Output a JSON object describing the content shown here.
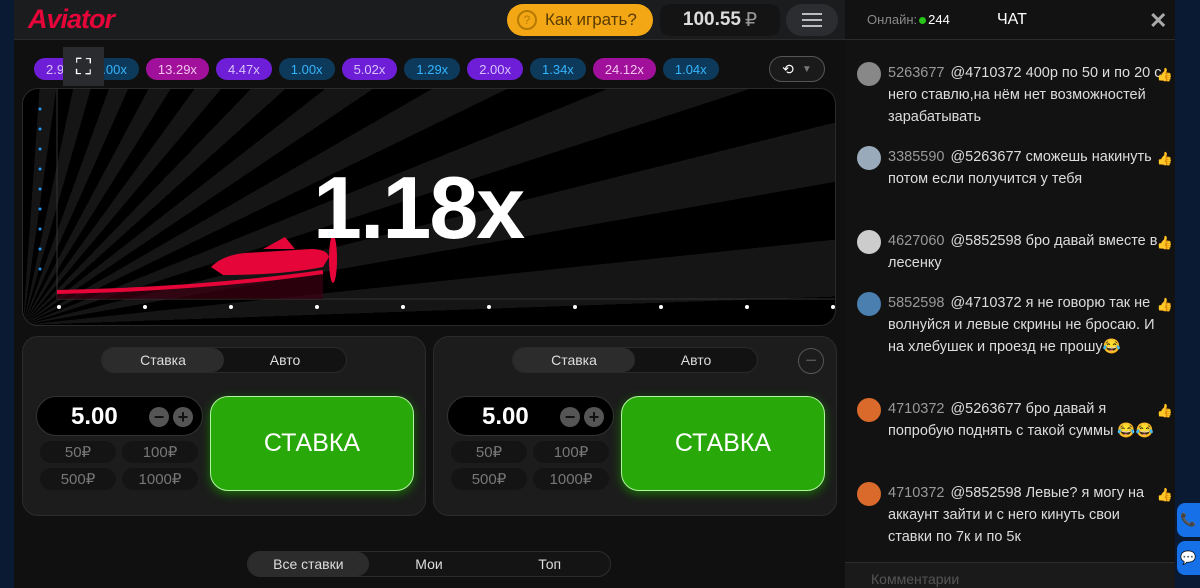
{
  "header": {
    "logo": "Aviator",
    "how_to_play": "Как играть?",
    "balance": "100.55",
    "currency": "₽"
  },
  "history": [
    {
      "value": "2.9",
      "color": "purple"
    },
    {
      "value": "1.00x",
      "color": "blue"
    },
    {
      "value": "13.29x",
      "color": "magenta"
    },
    {
      "value": "4.47x",
      "color": "purple"
    },
    {
      "value": "1.00x",
      "color": "blue"
    },
    {
      "value": "5.02x",
      "color": "purple"
    },
    {
      "value": "1.29x",
      "color": "blue"
    },
    {
      "value": "2.00x",
      "color": "purple"
    },
    {
      "value": "1.34x",
      "color": "blue"
    },
    {
      "value": "24.12x",
      "color": "magenta"
    },
    {
      "value": "1.04x",
      "color": "blue"
    }
  ],
  "game": {
    "multiplier": "1.18x",
    "plane_color": "#e50539"
  },
  "panels": [
    {
      "tabs": [
        "Ставка",
        "Авто"
      ],
      "amount": "5.00",
      "quick": [
        "50₽",
        "100₽",
        "500₽",
        "1000₽"
      ],
      "bet_label": "СТАВКА"
    },
    {
      "tabs": [
        "Ставка",
        "Авто"
      ],
      "amount": "5.00",
      "quick": [
        "50₽",
        "100₽",
        "500₽",
        "1000₽"
      ],
      "bet_label": "СТАВКА"
    }
  ],
  "bets_tabs": [
    "Все ставки",
    "Мои",
    "Топ"
  ],
  "chat": {
    "online_label": "Онлайн:",
    "online_count": "244",
    "title": "ЧАТ",
    "comment_placeholder": "Комментарии",
    "messages": [
      {
        "user": "5263677",
        "text": "@4710372 400р по 50 и по 20 с него ставлю,на нём нет возможностей зарабатывать"
      },
      {
        "user": "3385590",
        "text": "@5263677 сможешь накинуть потом если получится у тебя"
      },
      {
        "user": "4627060",
        "text": "@5852598 бро давай вместе в лесенку"
      },
      {
        "user": "5852598",
        "text": "@4710372 я не говорю так не волнуйся и левые скрины не бросаю. И на хлебушек и проезд не прошу😂"
      },
      {
        "user": "4710372",
        "text": "@5263677 бро давай я попробую поднять с такой суммы 😂😂"
      },
      {
        "user": "4710372",
        "text": "@5852598 Левые? я могу на аккаунт зайти и с него кинуть свои ставки по 7к и по 5к"
      }
    ]
  },
  "colors": {
    "accent": "#e50539",
    "bet_green": "#28a909",
    "howto": "#f3a715"
  }
}
